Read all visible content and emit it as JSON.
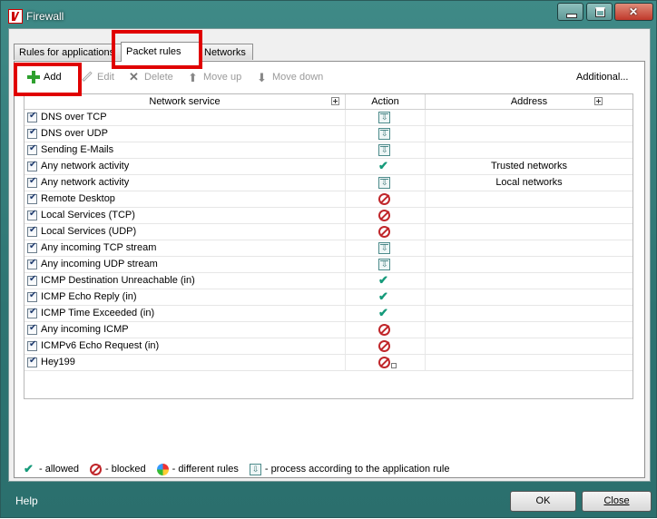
{
  "window": {
    "title": "Firewall"
  },
  "tabs": [
    {
      "label": "Rules for applications"
    },
    {
      "label": "Packet rules"
    },
    {
      "label": "Networks"
    }
  ],
  "toolbar": {
    "add": "Add",
    "edit": "Edit",
    "delete": "Delete",
    "move_up": "Move up",
    "move_down": "Move down",
    "additional": "Additional..."
  },
  "table": {
    "headers": {
      "service": "Network service",
      "action": "Action",
      "address": "Address"
    },
    "rows": [
      {
        "service": "DNS over TCP",
        "action": "app-rule",
        "address": ""
      },
      {
        "service": "DNS over UDP",
        "action": "app-rule",
        "address": ""
      },
      {
        "service": "Sending E-Mails",
        "action": "app-rule",
        "address": ""
      },
      {
        "service": "Any network activity",
        "action": "allowed",
        "address": "Trusted networks"
      },
      {
        "service": "Any network activity",
        "action": "app-rule",
        "address": "Local networks"
      },
      {
        "service": "Remote Desktop",
        "action": "blocked",
        "address": ""
      },
      {
        "service": "Local Services (TCP)",
        "action": "blocked",
        "address": ""
      },
      {
        "service": "Local Services (UDP)",
        "action": "blocked",
        "address": ""
      },
      {
        "service": "Any incoming TCP stream",
        "action": "app-rule",
        "address": ""
      },
      {
        "service": "Any incoming UDP stream",
        "action": "app-rule",
        "address": ""
      },
      {
        "service": "ICMP Destination Unreachable (in)",
        "action": "allowed",
        "address": ""
      },
      {
        "service": "ICMP Echo Reply (in)",
        "action": "allowed",
        "address": ""
      },
      {
        "service": "ICMP Time Exceeded (in)",
        "action": "allowed",
        "address": ""
      },
      {
        "service": "Any incoming ICMP",
        "action": "blocked",
        "address": ""
      },
      {
        "service": "ICMPv6 Echo Request (in)",
        "action": "blocked",
        "address": ""
      },
      {
        "service": "Hey199",
        "action": "blocked-sub",
        "address": ""
      }
    ]
  },
  "legend": {
    "allowed": "- allowed",
    "blocked": "- blocked",
    "different": "- different rules",
    "app_rule": "- process according to the application rule"
  },
  "footer": {
    "help": "Help",
    "ok": "OK",
    "close": "Close"
  },
  "colors": {
    "allowed": "#159a7a",
    "blocked": "#c0262a",
    "highlight": "#e00000"
  }
}
